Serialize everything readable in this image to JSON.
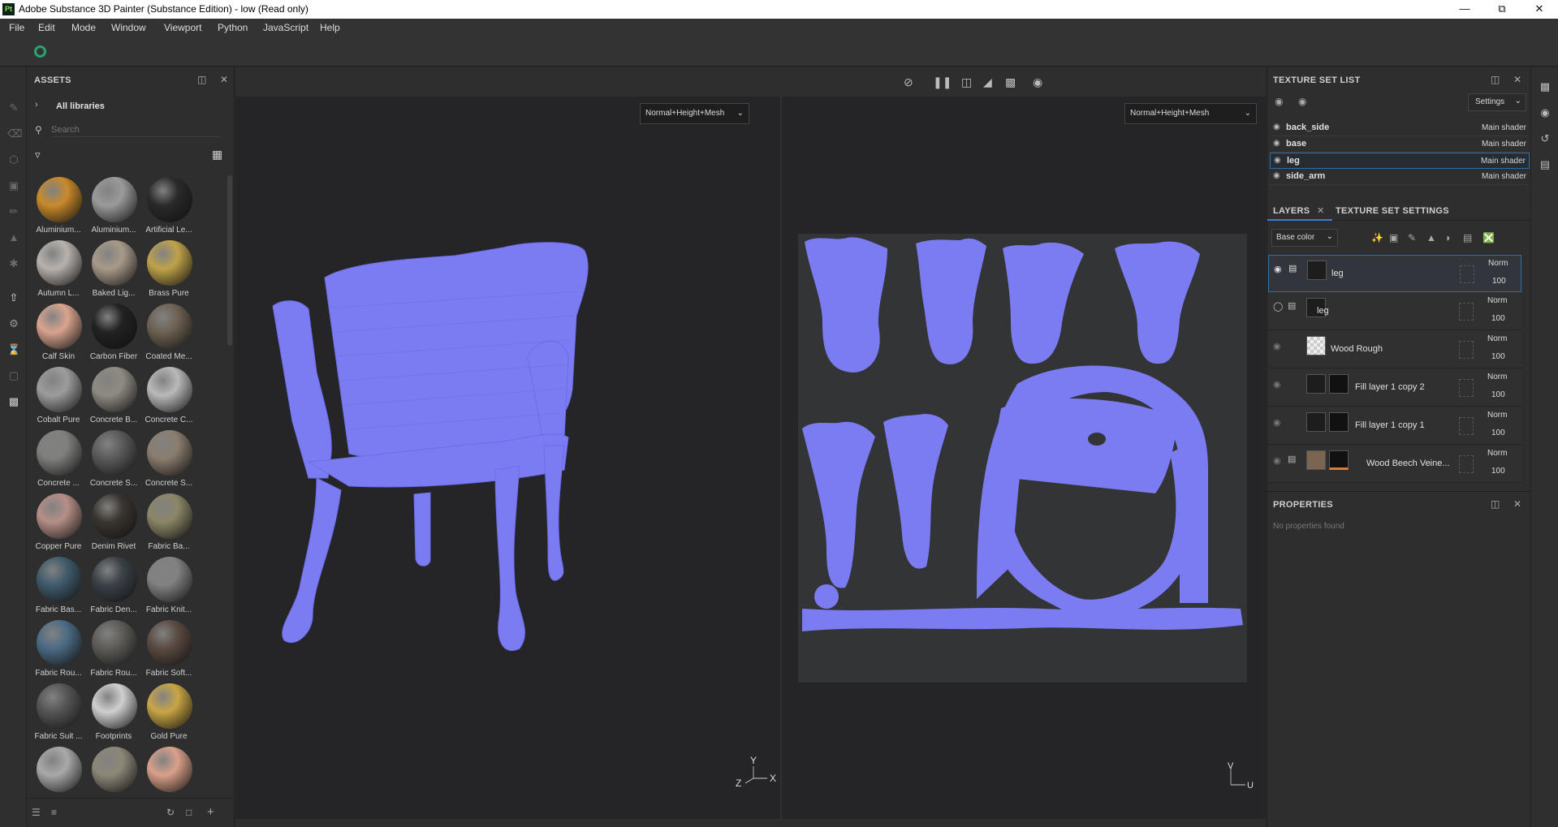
{
  "window": {
    "title": "Adobe Substance 3D Painter (Substance Edition) - low (Read only)",
    "logo": "Pt"
  },
  "menu": [
    "File",
    "Edit",
    "Mode",
    "Window",
    "Viewport",
    "Python",
    "JavaScript",
    "Help"
  ],
  "assets": {
    "title": "ASSETS",
    "library": "All libraries",
    "search_placeholder": "Search",
    "items": [
      {
        "label": "Aluminium...",
        "color": "#c98a2a"
      },
      {
        "label": "Aluminium...",
        "color": "#9a9a9a"
      },
      {
        "label": "Artificial Le...",
        "color": "#2a2a2a"
      },
      {
        "label": "Autumn L...",
        "color": "#b8b2ad"
      },
      {
        "label": "Baked Lig...",
        "color": "#a89a8a"
      },
      {
        "label": "Brass Pure",
        "color": "#bfa24a"
      },
      {
        "label": "Calf Skin",
        "color": "#d9a48e"
      },
      {
        "label": "Carbon Fiber",
        "color": "#222222"
      },
      {
        "label": "Coated Me...",
        "color": "#6d6253"
      },
      {
        "label": "Cobalt Pure",
        "color": "#9c9c9c"
      },
      {
        "label": "Concrete B...",
        "color": "#8f8a82"
      },
      {
        "label": "Concrete C...",
        "color": "#b9b9b9"
      },
      {
        "label": "Concrete ...",
        "color": "#7f7f7d"
      },
      {
        "label": "Concrete S...",
        "color": "#5a5a5a"
      },
      {
        "label": "Concrete S...",
        "color": "#8a7d6e"
      },
      {
        "label": "Copper Pure",
        "color": "#b58f86"
      },
      {
        "label": "Denim Rivet",
        "color": "#3a3530"
      },
      {
        "label": "Fabric Ba...",
        "color": "#8b8668"
      },
      {
        "label": "Fabric Bas...",
        "color": "#3f5a6b"
      },
      {
        "label": "Fabric Den...",
        "color": "#3b4148"
      },
      {
        "label": "Fabric Knit...",
        "color": "#818181"
      },
      {
        "label": "Fabric Rou...",
        "color": "#4b6b84"
      },
      {
        "label": "Fabric Rou...",
        "color": "#5d5c58"
      },
      {
        "label": "Fabric Soft...",
        "color": "#5a4a41"
      },
      {
        "label": "Fabric Suit ...",
        "color": "#555555"
      },
      {
        "label": "Footprints",
        "color": "#cfcfcf"
      },
      {
        "label": "Gold Pure",
        "color": "#c9a545"
      },
      {
        "label": "",
        "color": "#a9a9a9"
      },
      {
        "label": "",
        "color": "#8d8778"
      },
      {
        "label": "",
        "color": "#d9a08a"
      }
    ]
  },
  "viewport": {
    "left_mode": "Normal+Height+Mesh",
    "right_mode": "Normal+Height+Mesh",
    "mesh_color": "#7b7bf2",
    "axis_3d": {
      "x": "X",
      "y": "Y",
      "z": "Z"
    },
    "axis_uv": {
      "u": "U",
      "v": "V"
    }
  },
  "texture_set_list": {
    "title": "TEXTURE SET LIST",
    "settings_label": "Settings",
    "sets": [
      {
        "name": "back_side",
        "shader": "Main shader"
      },
      {
        "name": "base",
        "shader": "Main shader"
      },
      {
        "name": "leg",
        "shader": "Main shader"
      },
      {
        "name": "side_arm",
        "shader": "Main shader"
      }
    ]
  },
  "layers": {
    "tab_layers": "LAYERS",
    "tab_settings": "TEXTURE SET SETTINGS",
    "channel": "Base color",
    "rows": [
      {
        "name": "leg",
        "blend": "Norm",
        "opacity": "100"
      },
      {
        "name": "leg",
        "blend": "Norm",
        "opacity": "100"
      },
      {
        "name": "Wood Rough",
        "blend": "Norm",
        "opacity": "100"
      },
      {
        "name": "Fill layer 1 copy 2",
        "blend": "Norm",
        "opacity": "100"
      },
      {
        "name": "Fill layer 1 copy 1",
        "blend": "Norm",
        "opacity": "100"
      },
      {
        "name": "Wood Beech Veine...",
        "blend": "Norm",
        "opacity": "100"
      }
    ]
  },
  "properties": {
    "title": "PROPERTIES",
    "empty_text": "No properties found"
  }
}
